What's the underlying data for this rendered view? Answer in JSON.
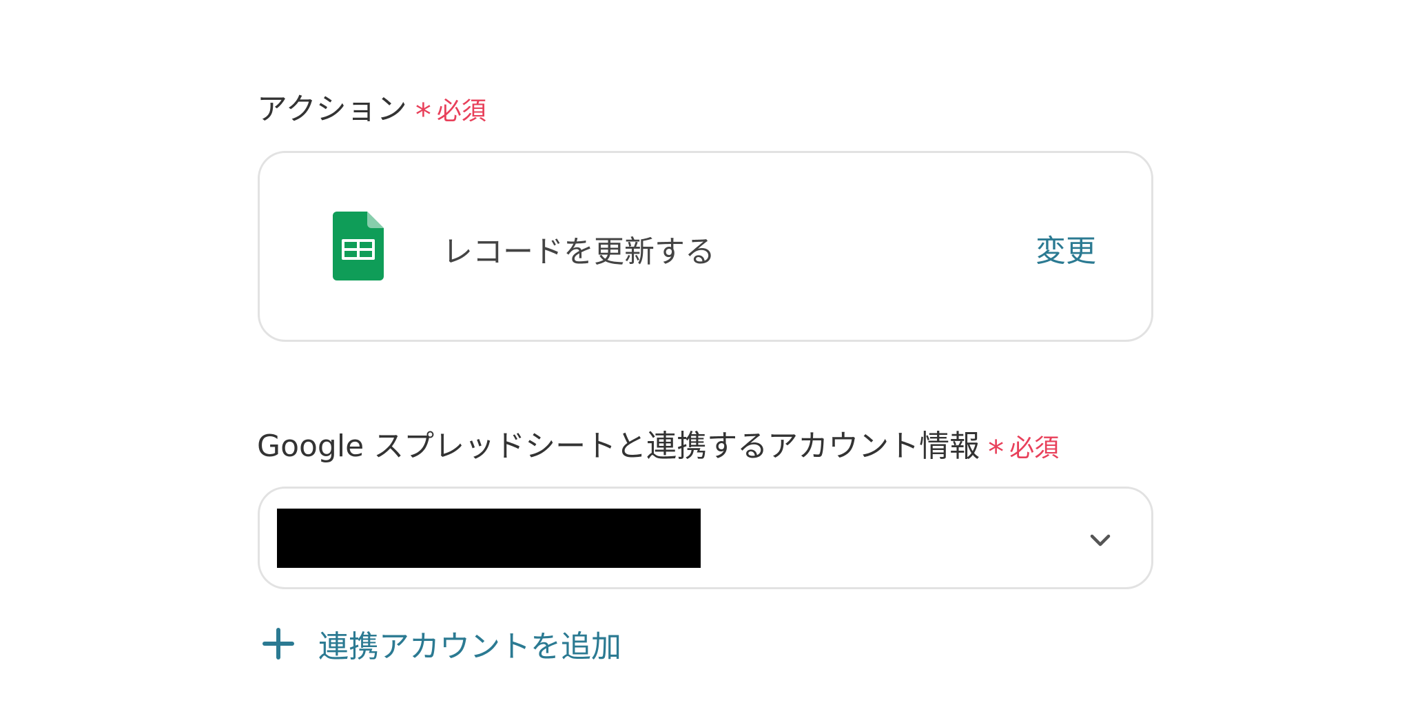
{
  "action_section": {
    "label": "アクション",
    "required_mark": "*",
    "required_text": "必須",
    "card": {
      "icon": "google-sheets-icon",
      "action_name": "レコードを更新する",
      "change_label": "変更"
    }
  },
  "account_section": {
    "label": "Google スプレッドシートと連携するアカウント情報",
    "required_mark": "*",
    "required_text": "必須",
    "selected_value": "",
    "dropdown_icon": "chevron-down-icon"
  },
  "add_account": {
    "icon": "plus-icon",
    "label": "連携アカウントを追加"
  },
  "colors": {
    "required": "#e8405a",
    "link": "#2b7a92",
    "sheets_green": "#0f9d58",
    "border": "#e2e2e2",
    "text": "#333333"
  }
}
